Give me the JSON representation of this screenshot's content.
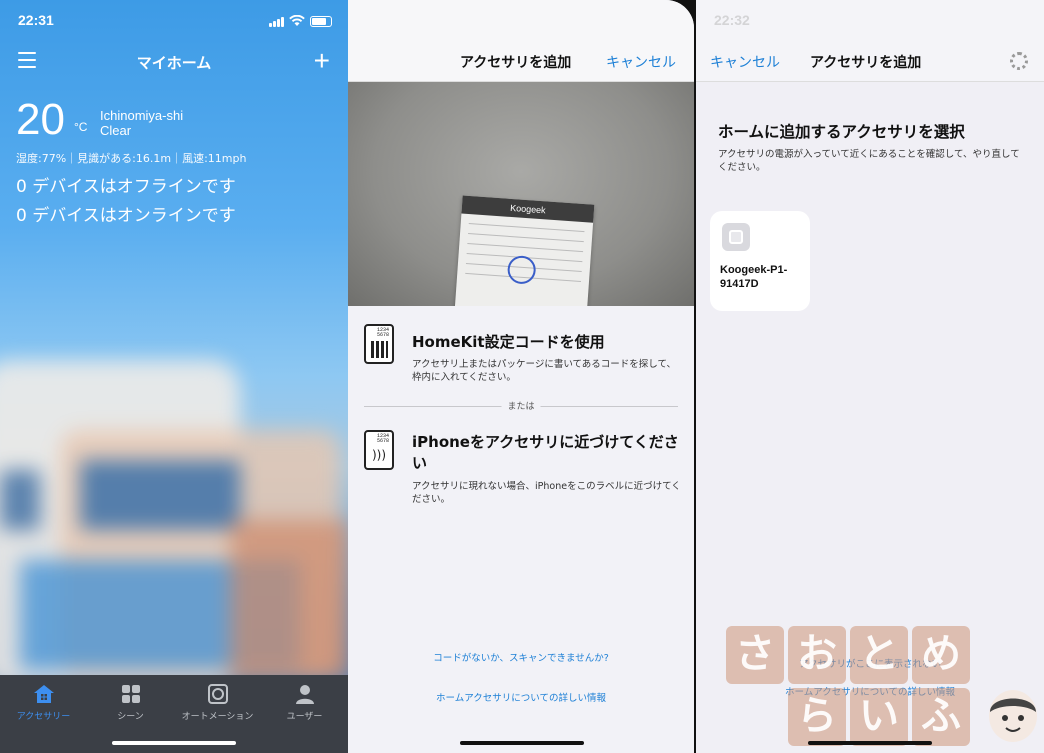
{
  "panel1": {
    "status_time": "22:31",
    "nav_title": "マイホーム",
    "temperature": "20",
    "temp_unit": "°C",
    "city": "Ichinomiya-shi",
    "condition": "Clear",
    "weather_detail": "湿度:77%｜見識がある:16.1m｜風速:11mph",
    "offline_text": "0 デバイスはオフラインです",
    "online_text": "0 デバイスはオンラインです",
    "tabs": [
      {
        "label": "アクセサリー",
        "icon": "house-icon",
        "active": true
      },
      {
        "label": "シーン",
        "icon": "grid-icon",
        "active": false
      },
      {
        "label": "オートメーション",
        "icon": "automation-icon",
        "active": false
      },
      {
        "label": "ユーザー",
        "icon": "user-icon",
        "active": false
      }
    ],
    "accent_color": "#3d8ff0"
  },
  "panel2": {
    "title": "アクセサリを追加",
    "cancel": "キャンセル",
    "card_brand": "Koogeek",
    "option1_title": "HomeKit設定コードを使用",
    "option1_desc": "アクセサリ上またはパッケージに書いてあるコードを探して、枠内に入れてください。",
    "icon_digits": "1234\n5678",
    "divider_text": "または",
    "option2_title": "iPhoneをアクセサリに近づけてください",
    "option2_desc": "アクセサリに現れない場合、iPhoneをこのラベルに近づけてください。",
    "link_no_code": "コードがないか、スキャンできませんか?",
    "link_more_info": "ホームアクセサリについての詳しい情報"
  },
  "panel3": {
    "status_time": "22:32",
    "cancel": "キャンセル",
    "title": "アクセサリを追加",
    "heading": "ホームに追加するアクセサリを選択",
    "subtext": "アクセサリの電源が入っていて近くにあることを確認して、やり直してください。",
    "accessory_name": "Koogeek-P1-91417D",
    "link_not_shown": "アクセサリがここに表示されない",
    "link_more_info": "ホームアクセサリについての詳しい情報",
    "watermark_chars": [
      "さ",
      "お",
      "と",
      "め",
      "ら",
      "い",
      "ふ"
    ]
  }
}
